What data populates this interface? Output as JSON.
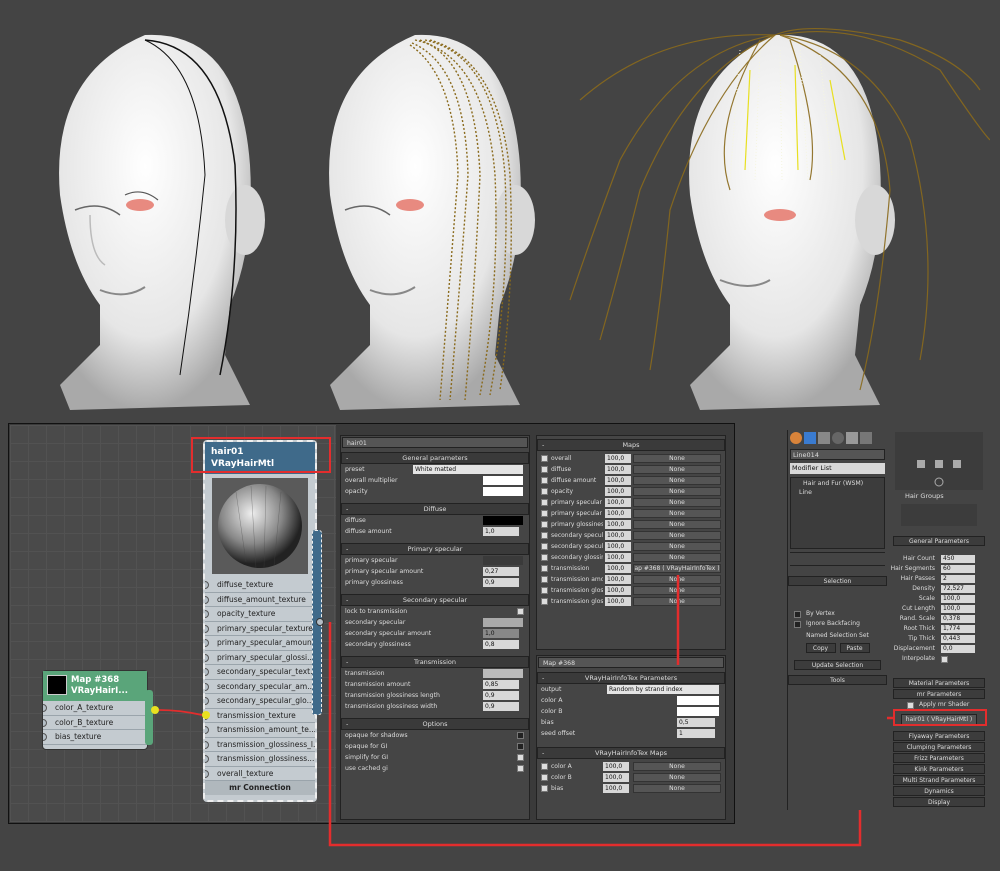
{
  "node_editor": {
    "hair_node": {
      "name": "hair01",
      "type": "VRayHairMtl",
      "slots": [
        "diffuse_texture",
        "diffuse_amount_texture",
        "opacity_texture",
        "primary_specular_texture",
        "primary_specular_amoun...",
        "primary_specular_glossi...",
        "secondary_specular_text...",
        "secondary_specular_am...",
        "secondary_specular_glo...",
        "transmission_texture",
        "transmission_amount_te...",
        "transmission_glossiness_l...",
        "transmission_glossiness...",
        "overall_texture"
      ],
      "footer": "mr Connection"
    },
    "map_node": {
      "name": "Map #368",
      "type": "VRayHairI...",
      "slots": [
        "color_A_texture",
        "color_B_texture",
        "bias_texture"
      ]
    }
  },
  "material_params": {
    "title": "hair01",
    "general": {
      "header": "General parameters",
      "preset_label": "preset",
      "preset_value": "White matted",
      "overall_label": "overall multiplier",
      "opacity_label": "opacity"
    },
    "diffuse": {
      "header": "Diffuse",
      "diffuse_label": "diffuse",
      "amount_label": "diffuse amount",
      "amount_value": "1,0"
    },
    "primary": {
      "header": "Primary specular",
      "spec_label": "primary specular",
      "amount_label": "primary specular amount",
      "amount_value": "0,27",
      "gloss_label": "primary glossiness",
      "gloss_value": "0,9"
    },
    "secondary": {
      "header": "Secondary specular",
      "lock_label": "lock to transmission",
      "spec_label": "secondary specular",
      "amount_label": "secondary specular amount",
      "amount_value": "1,0",
      "gloss_label": "secondary glossiness",
      "gloss_value": "0,8"
    },
    "transmission": {
      "header": "Transmission",
      "trans_label": "transmission",
      "amount_label": "transmission amount",
      "amount_value": "0,85",
      "gl_label": "transmission glossiness length",
      "gl_value": "0,9",
      "gw_label": "transmission glossiness width",
      "gw_value": "0,9"
    },
    "options": {
      "header": "Options",
      "items": [
        "opaque for shadows",
        "opaque for GI",
        "simplify for GI",
        "use cached gi"
      ]
    }
  },
  "maps_panel": {
    "header": "Maps",
    "rows": [
      {
        "label": "overall",
        "value": "100,0",
        "map": "None"
      },
      {
        "label": "diffuse",
        "value": "100,0",
        "map": "None"
      },
      {
        "label": "diffuse amount",
        "value": "100,0",
        "map": "None"
      },
      {
        "label": "opacity",
        "value": "100,0",
        "map": "None"
      },
      {
        "label": "primary specular",
        "value": "100,0",
        "map": "None"
      },
      {
        "label": "primary specular am",
        "value": "100,0",
        "map": "None"
      },
      {
        "label": "primary glossiness",
        "value": "100,0",
        "map": "None"
      },
      {
        "label": "secondary specular",
        "value": "100,0",
        "map": "None"
      },
      {
        "label": "secondary specular",
        "value": "100,0",
        "map": "None"
      },
      {
        "label": "secondary glossine",
        "value": "100,0",
        "map": "None"
      },
      {
        "label": "transmission",
        "value": "100,0",
        "map": "ap #368 ( VRayHairInfoTex )"
      },
      {
        "label": "transmission amou",
        "value": "100,0",
        "map": "None"
      },
      {
        "label": "transmission glossi",
        "value": "100,0",
        "map": "None"
      },
      {
        "label": "transmission glossi",
        "value": "100,0",
        "map": "None"
      }
    ]
  },
  "map368_panel": {
    "title": "Map #368",
    "params_header": "VRayHairInfoTex Parameters",
    "output_label": "output",
    "output_value": "Random by strand index",
    "colorA_label": "color A",
    "colorB_label": "color B",
    "bias_label": "bias",
    "bias_value": "0,5",
    "seed_label": "seed offset",
    "seed_value": "1",
    "maps_header": "VRayHairInfoTex Maps",
    "map_rows": [
      {
        "label": "color A",
        "value": "100,0",
        "map": "None"
      },
      {
        "label": "color B",
        "value": "100,0",
        "map": "None"
      },
      {
        "label": "bias",
        "value": "100,0",
        "map": "None"
      }
    ]
  },
  "command_panel": {
    "object_name": "Line014",
    "modifier_list": "Modifier List",
    "stack": [
      "Hair and Fur (WSM)",
      "Line"
    ],
    "selection": {
      "header": "Selection",
      "by_vertex": "By Vertex",
      "ignore_backfacing": "Ignore Backfacing",
      "named_sets": "Named Selection Set",
      "copy": "Copy",
      "paste": "Paste",
      "update": "Update Selection"
    },
    "tools": "Tools",
    "hair_groups": "Hair Groups",
    "general_header": "General Parameters",
    "params": [
      {
        "label": "Hair Count",
        "value": "450"
      },
      {
        "label": "Hair Segments",
        "value": "60"
      },
      {
        "label": "Hair Passes",
        "value": "2"
      },
      {
        "label": "Density",
        "value": "72,527"
      },
      {
        "label": "Scale",
        "value": "100,0"
      },
      {
        "label": "Cut Length",
        "value": "100,0"
      },
      {
        "label": "Rand. Scale",
        "value": "0,378"
      },
      {
        "label": "Root Thick",
        "value": "1,774"
      },
      {
        "label": "Tip Thick",
        "value": "0,443"
      },
      {
        "label": "Displacement",
        "value": "0,0"
      }
    ],
    "interpolate": "Interpolate",
    "material_params": "Material Parameters",
    "mr_params": "mr Parameters",
    "apply_mr": "Apply mr Shader",
    "mr_shader": "hair01 ( VRayHairMtl )",
    "rollouts": [
      "Flyaway Parameters",
      "Clumping Parameters",
      "Frizz Parameters",
      "Kink Parameters",
      "Multi Strand Parameters",
      "Dynamics",
      "Display"
    ]
  },
  "colors": {
    "hair": "#8a6a1c",
    "highlight": "#e32d2d",
    "node_header": "#3f6a8a",
    "map_header": "#5aa57a"
  }
}
